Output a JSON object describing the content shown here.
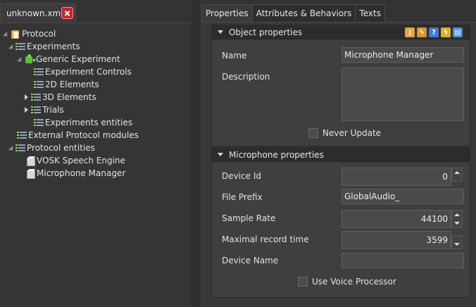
{
  "file_tab": {
    "label": "unknown.xml"
  },
  "tree": {
    "items": [
      {
        "label": "Protocol"
      },
      {
        "label": "Experiments"
      },
      {
        "label": "Generic Experiment"
      },
      {
        "label": "Experiment Controls"
      },
      {
        "label": "2D Elements"
      },
      {
        "label": "3D Elements"
      },
      {
        "label": "Trials"
      },
      {
        "label": "Experiments entities"
      },
      {
        "label": "External Protocol modules"
      },
      {
        "label": "Protocol entities"
      },
      {
        "label": "VOSK Speech Engine"
      },
      {
        "label": "Microphone Manager"
      }
    ]
  },
  "tabs": [
    {
      "label": "Properties"
    },
    {
      "label": "Attributes & Behaviors"
    },
    {
      "label": "Texts"
    }
  ],
  "object_properties": {
    "title": "Object properties",
    "name_label": "Name",
    "name_value": "Microphone Manager",
    "description_label": "Description",
    "description_value": "",
    "never_update_label": "Never Update",
    "never_update_checked": false
  },
  "microphone_properties": {
    "title": "Microphone properties",
    "device_id_label": "Device Id",
    "device_id_value": "0",
    "file_prefix_label": "File Prefix",
    "file_prefix_value": "GlobalAudio_",
    "sample_rate_label": "Sample Rate",
    "sample_rate_value": "44100",
    "max_record_label": "Maximal record time",
    "max_record_value": "3599",
    "device_name_label": "Device Name",
    "device_name_value": "",
    "voice_processor_label": "Use Voice Processor",
    "voice_processor_checked": false
  },
  "toolbar_icons": [
    "key-icon",
    "key-edit-icon",
    "help-icon",
    "lightning-icon",
    "save-icon"
  ],
  "colors": {
    "close_button": "#c8262d",
    "icon_key": "#e8a43a",
    "icon_help": "#3a7fd6",
    "icon_save": "#4a90d9"
  }
}
